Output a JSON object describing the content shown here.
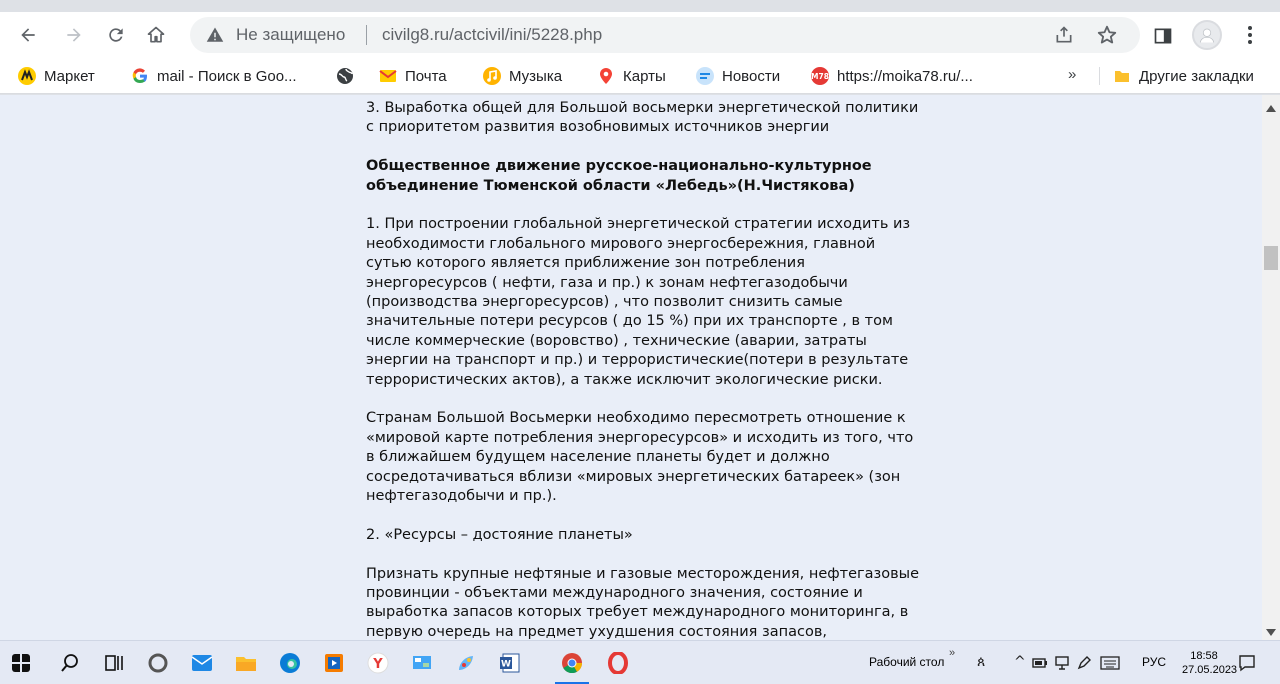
{
  "browser": {
    "address": {
      "security_status": "Не защищено",
      "url": "civilg8.ru/actcivil/ini/5228.php"
    }
  },
  "bookmarks": {
    "items": [
      {
        "label": "Маркет",
        "icon": "yandex-market-icon"
      },
      {
        "label": "mail - Поиск в Goo...",
        "icon": "google-icon"
      },
      {
        "label": "",
        "icon": "globe-icon"
      },
      {
        "label": "Почта",
        "icon": "mail-icon"
      },
      {
        "label": "Музыка",
        "icon": "music-icon"
      },
      {
        "label": "Карты",
        "icon": "maps-pin-icon"
      },
      {
        "label": "Новости",
        "icon": "news-icon"
      },
      {
        "label": "https://moika78.ru/...",
        "icon": "m78-icon"
      }
    ],
    "more_label": "»",
    "other_bookmarks": "Другие закладки"
  },
  "article": {
    "p1": [
      "3. Выработка общей для Большой восьмерки энергетической политики",
      "с приоритетом развития возобновимых источников энергии"
    ],
    "heading": [
      "Общественное движение русское-национально-культурное",
      "объединение Тюменской области «Лебедь»(Н.Чистякова)"
    ],
    "p2": [
      "1. При построении глобальной энергетической стратегии исходить из",
      "необходимости глобального мирового энергосбережния, главной",
      "сутью которого является приближение зон потребления",
      "энергоресурсов ( нефти, газа и пр.) к зонам нефтегазодобычи",
      "(производства энергоресурсов) , что позволит снизить самые",
      "значительные потери ресурсов ( до 15 %) при их транспорте , в том",
      "числе коммерческие (воровство) , технические (аварии, затраты",
      "энергии на транспорт и пр.) и террористические(потери в результате",
      "террористических актов), а также исключит экологические риски."
    ],
    "p3": [
      "Странам Большой Восьмерки необходимо пересмотреть отношение к",
      "«мировой карте потребления энергоресурсов» и исходить из того, что",
      "в ближайшем будущем население планеты будет и должно",
      "сосредотачиваться вблизи «мировых энергетических батареек» (зон",
      "нефтегазодобычи и пр.)."
    ],
    "p4": [
      "2. «Ресурсы – достояние планеты»"
    ],
    "p5": [
      "Признать крупные нефтяные и газовые месторождения, нефтегазовые",
      "провинции - объектами международного значения, состояние и",
      "выработка запасов которых требует международного мониторинга, в",
      "первую очередь на предмет ухудшения состояния запасов,"
    ]
  },
  "taskbar": {
    "desktop_label": "Рабочий стол",
    "chevron": "»",
    "language": "РУС",
    "time": "18:58",
    "date": "27.05.2023"
  },
  "colors": {
    "page_background": "#e9eef8",
    "accent_chrome": "#1a73e8"
  }
}
